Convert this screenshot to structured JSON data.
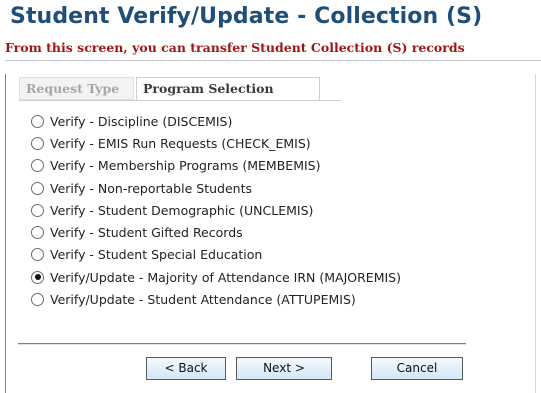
{
  "page": {
    "title": "Student Verify/Update - Collection (S)",
    "subtitle": "From this screen, you can transfer Student Collection (S) records"
  },
  "tabs": [
    {
      "label": "Request Type",
      "active": false
    },
    {
      "label": "Program Selection",
      "active": true
    }
  ],
  "options": [
    {
      "label": "Verify - Discipline (DISCEMIS)",
      "selected": false
    },
    {
      "label": "Verify - EMIS Run Requests (CHECK_EMIS)",
      "selected": false
    },
    {
      "label": "Verify - Membership Programs (MEMBEMIS)",
      "selected": false
    },
    {
      "label": "Verify - Non-reportable Students",
      "selected": false
    },
    {
      "label": "Verify - Student Demographic (UNCLEMIS)",
      "selected": false
    },
    {
      "label": "Verify - Student Gifted Records",
      "selected": false
    },
    {
      "label": "Verify - Student Special Education",
      "selected": false
    },
    {
      "label": "Verify/Update - Majority of Attendance IRN (MAJOREMIS)",
      "selected": true
    },
    {
      "label": "Verify/Update - Student Attendance (ATTUPEMIS)",
      "selected": false
    }
  ],
  "buttons": {
    "back": "< Back",
    "next": "Next >",
    "cancel": "Cancel"
  }
}
